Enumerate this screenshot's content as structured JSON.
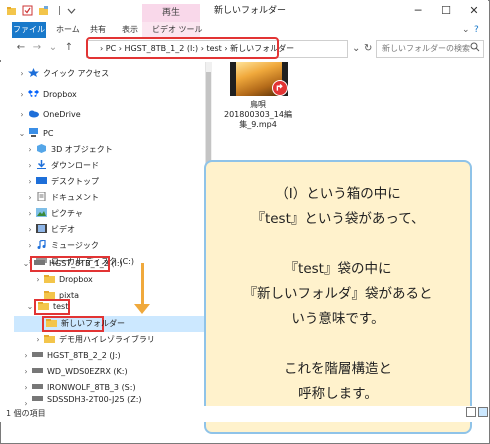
{
  "titlebar": {
    "play_tab": "再生",
    "window_title": "新しいフォルダー",
    "separator": "|",
    "minimize": "─",
    "maximize": "☐",
    "close": "✕"
  },
  "ribbon": {
    "file": "ファイル",
    "tabs": [
      "ホーム",
      "共有",
      "表示",
      "ビデオ ツール"
    ],
    "expand": "⌄",
    "help": "?"
  },
  "nav": {
    "back": "←",
    "forward": "→",
    "up_history": "⌄",
    "up": "↑",
    "address_prefix": "›",
    "path": [
      "PC",
      "HGST_8TB_1_2 (I:)",
      "test",
      "新しいフォルダー"
    ],
    "dropdown": "⌄",
    "refresh": "↻",
    "search_placeholder": "新しいフォルダーの検索"
  },
  "tree": [
    {
      "label": "クイック アクセス",
      "chev": "›",
      "icon": "star-icon"
    },
    {
      "label": "Dropbox",
      "chev": "›",
      "icon": "dropbox-icon"
    },
    {
      "label": "OneDrive",
      "chev": "›",
      "icon": "cloud-icon"
    },
    {
      "label": "PC",
      "chev": "⌄",
      "icon": "pc-icon"
    },
    {
      "label": "3D オブジェクト",
      "chev": "›",
      "icon": "cube-icon"
    },
    {
      "label": "ダウンロード",
      "chev": "›",
      "icon": "download-icon"
    },
    {
      "label": "デスクトップ",
      "chev": "›",
      "icon": "desktop-icon"
    },
    {
      "label": "ドキュメント",
      "chev": "›",
      "icon": "document-icon"
    },
    {
      "label": "ピクチャ",
      "chev": "›",
      "icon": "picture-icon"
    },
    {
      "label": "ビデオ",
      "chev": "›",
      "icon": "video-icon"
    },
    {
      "label": "ミュージック",
      "chev": "›",
      "icon": "music-icon"
    },
    {
      "label": "ローカル ディスク (C:)",
      "chev": "›",
      "icon": "drive-icon"
    },
    {
      "label": "HGST_8TB_1_2 (I:)",
      "chev": "⌄",
      "icon": "drive-icon"
    },
    {
      "label": "Dropbox",
      "chev": "›",
      "icon": "folder-icon"
    },
    {
      "label": "pixta",
      "chev": "",
      "icon": "folder-icon"
    },
    {
      "label": "test",
      "chev": "⌄",
      "icon": "folder-icon"
    },
    {
      "label": "新しいフォルダー",
      "chev": "",
      "icon": "folder-icon"
    },
    {
      "label": "デモ用ハイレゾライブラリ",
      "chev": "›",
      "icon": "folder-icon"
    },
    {
      "label": "HGST_8TB_2_2 (J:)",
      "chev": "›",
      "icon": "drive-icon"
    },
    {
      "label": "WD_WDS0EZRX (K:)",
      "chev": "›",
      "icon": "drive-icon"
    },
    {
      "label": "IRONWOLF_8TB_3 (S:)",
      "chev": "›",
      "icon": "drive-icon"
    },
    {
      "label": "SDSSDH3-2T00-J25 (Z:)",
      "chev": "›",
      "icon": "drive-icon"
    }
  ],
  "file": {
    "name_lines": [
      "鳥唄",
      "201800303_14編",
      "集_9.mp4"
    ]
  },
  "callout": {
    "text": "（I）という箱の中に\n『test』という袋があって、\n\n『test』袋の中に\n『新しいフォルダ』袋があると\nいう意味です。\n\nこれを階層構造と\n呼称します。"
  },
  "status": {
    "items": "1 個の項目"
  },
  "colors": {
    "file_tab": "#1979ca",
    "highlight_red": "#e23434",
    "arrow_orange": "#f0a93c",
    "callout_bg": "#fff2cc",
    "callout_border": "#8fc3e8",
    "selection": "#cce8ff"
  }
}
